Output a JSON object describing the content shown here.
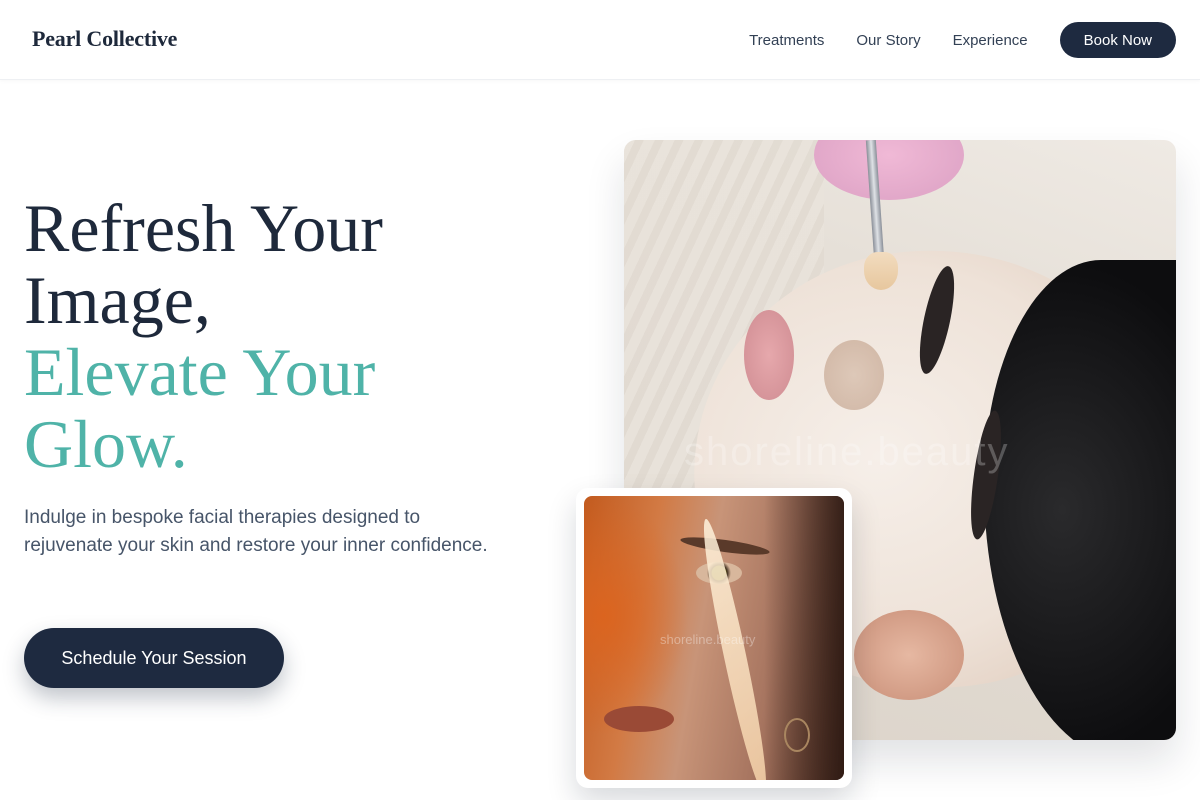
{
  "header": {
    "brand": "Pearl Collective",
    "nav": [
      "Treatments",
      "Our Story",
      "Experience"
    ],
    "book_label": "Book Now"
  },
  "hero": {
    "headline_line1": "Refresh Your",
    "headline_line2": "Image,",
    "accent_line1": "Elevate Your",
    "accent_line2": "Glow.",
    "description": "Indulge in bespoke facial therapies designed to rejuvenate your skin and restore your inner confidence.",
    "cta_label": "Schedule Your Session"
  },
  "images": {
    "main_watermark": "shoreline.beauty",
    "inset_watermark": "shoreline.beauty"
  },
  "colors": {
    "navy": "#1e2a40",
    "accent_teal": "#4fb3a8",
    "body_text": "#475569"
  }
}
